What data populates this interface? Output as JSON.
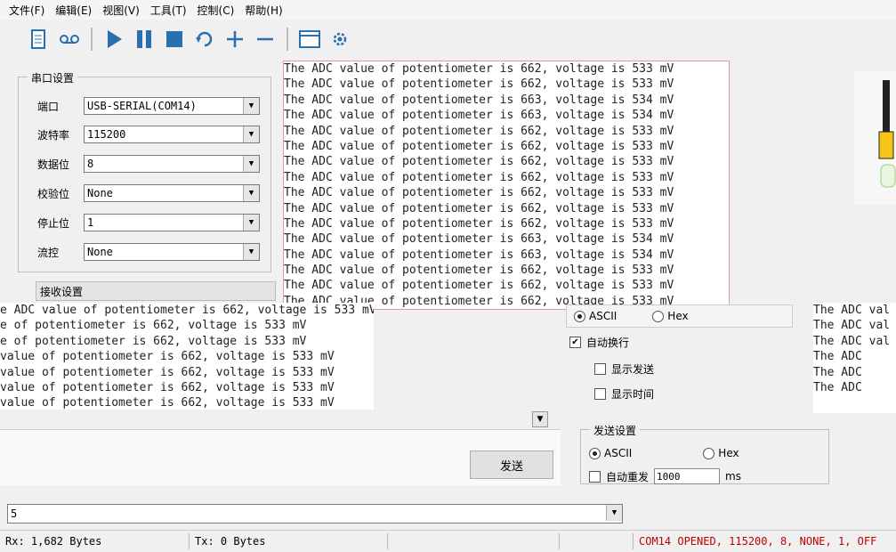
{
  "menu": [
    "文件(F)",
    "编辑(E)",
    "视图(V)",
    "工具(T)",
    "控制(C)",
    "帮助(H)"
  ],
  "toolbar_icons": [
    "document-icon",
    "tape-icon",
    "play-icon",
    "pause-icon",
    "stop-icon",
    "refresh-icon",
    "plus-icon",
    "minus-icon",
    "window-icon",
    "settings-icon"
  ],
  "serial": {
    "title": "串口设置",
    "port_label": "端口",
    "port_value": "USB-SERIAL(COM14)",
    "baud_label": "波特率",
    "baud_value": "115200",
    "data_label": "数据位",
    "data_value": "8",
    "parity_label": "校验位",
    "parity_value": "None",
    "stop_label": "停止位",
    "stop_value": "1",
    "flow_label": "流控",
    "flow_value": "None"
  },
  "receive": {
    "title": "接收设置",
    "ascii_label": "ASCII",
    "hex_label": "Hex",
    "auto_wrap_label": "自动换行",
    "show_send_label": "显示发送",
    "show_time_label": "显示时间"
  },
  "send_settings": {
    "title": "发送设置",
    "ascii_label": "ASCII",
    "hex_label": "Hex",
    "auto_resend_label": "自动重发",
    "interval_value": "1000",
    "interval_unit": "ms"
  },
  "send_button": "发送",
  "send_input_value": "5",
  "console_lines": [
    "The ADC value of potentiometer is 662, voltage is 533 mV",
    "The ADC value of potentiometer is 662, voltage is 533 mV",
    "The ADC value of potentiometer is 663, voltage is 534 mV",
    "The ADC value of potentiometer is 663, voltage is 534 mV",
    "The ADC value of potentiometer is 662, voltage is 533 mV",
    "The ADC value of potentiometer is 662, voltage is 533 mV",
    "The ADC value of potentiometer is 662, voltage is 533 mV",
    "The ADC value of potentiometer is 662, voltage is 533 mV",
    "The ADC value of potentiometer is 662, voltage is 533 mV",
    "The ADC value of potentiometer is 662, voltage is 533 mV",
    "The ADC value of potentiometer is 662, voltage is 533 mV",
    "The ADC value of potentiometer is 663, voltage is 534 mV",
    "The ADC value of potentiometer is 663, voltage is 534 mV",
    "The ADC value of potentiometer is 662, voltage is 533 mV",
    "The ADC value of potentiometer is 662, voltage is 533 mV",
    "The ADC value of potentiometer is 662, voltage is 533 mV"
  ],
  "left_console_lines": [
    "e ADC value of potentiometer is 662, voltage is 533 mV",
    "e of potentiometer is 662, voltage is 533 mV",
    "e of potentiometer is 662, voltage is 533 mV",
    "value of potentiometer is 662, voltage is 533 mV",
    "value of potentiometer is 662, voltage is 533 mV",
    "value of potentiometer is 662, voltage is 533 mV",
    "value of potentiometer is 662, voltage is 533 mV"
  ],
  "right_console_lines": [
    "The ADC val",
    "The ADC val",
    "The ADC val",
    "The ADC",
    "The ADC",
    "The ADC"
  ],
  "status": {
    "rx": "Rx: 1,682 Bytes",
    "tx": "Tx: 0 Bytes",
    "port_info": "COM14 OPENED, 115200, 8, NONE, 1, OFF"
  }
}
